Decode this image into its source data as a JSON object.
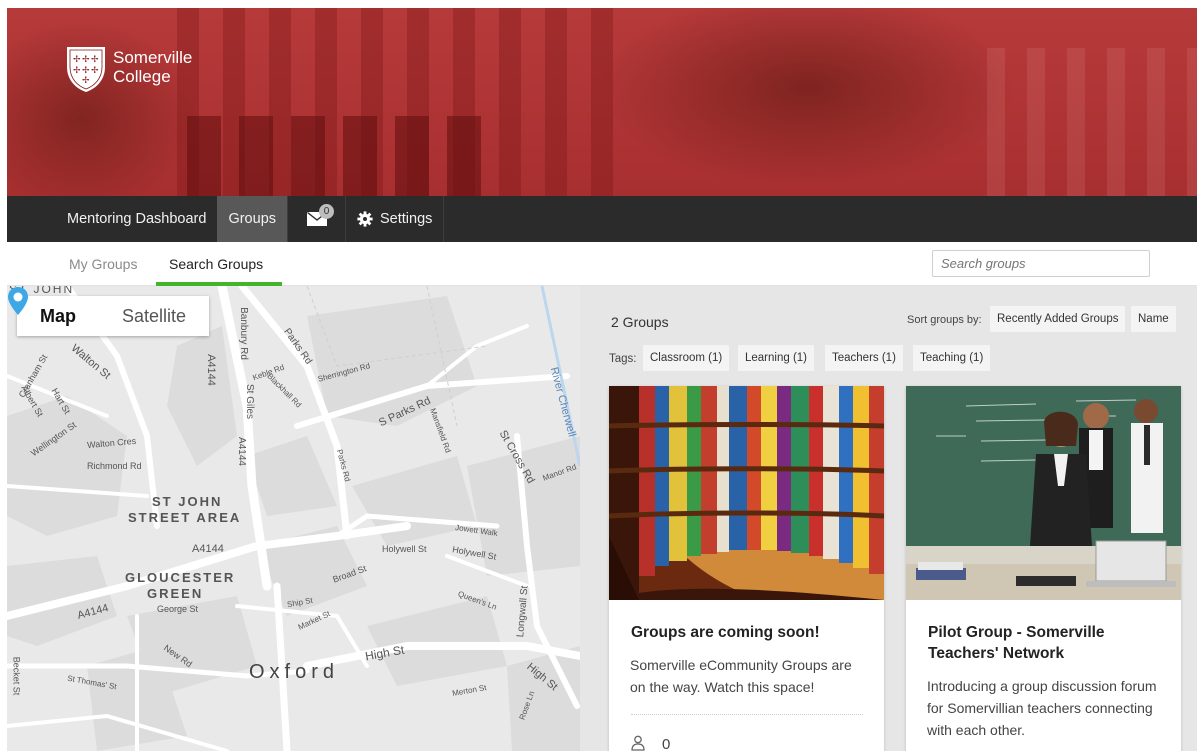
{
  "brand": {
    "line1": "Somerville",
    "line2": "College"
  },
  "nav": {
    "items": [
      {
        "label": "Mentoring Dashboard"
      },
      {
        "label": "Groups"
      }
    ],
    "messages_count": "0",
    "settings_label": "Settings"
  },
  "subnav": {
    "my_groups": "My Groups",
    "search_groups": "Search Groups",
    "search_placeholder": "Search groups"
  },
  "map": {
    "toggle": {
      "map": "Map",
      "satellite": "Satellite"
    },
    "city": "Oxford",
    "areas": {
      "st_john_1": "ST JOHN",
      "st_john_2": "STREET AREA",
      "glouc_1": "GLOUCESTER",
      "glouc_2": "GREEN"
    },
    "streets": {
      "banbury": "Banbury Rd",
      "parks_rd": "Parks Rd",
      "keble": "Keble Rd",
      "sherrington": "Sherrington Rd",
      "s_parks": "S Parks Rd",
      "river": "River Cherwell",
      "st_cross": "St Cross Rd",
      "manor": "Manor Rd",
      "walton_st": "Walton St",
      "walton_cres": "Walton Cres",
      "richmond": "Richmond Rd",
      "wellington": "Wellington St",
      "st_giles": "St Giles",
      "a4144": "A4144",
      "mansfield": "Mansfield Rd",
      "jowett": "Jowett Walk",
      "holywell": "Holywell St",
      "broad": "Broad St",
      "george": "George St",
      "ship": "Ship St",
      "market": "Market St",
      "new_rd": "New Rd",
      "high": "High St",
      "longwall": "Longwall St",
      "queens": "Queen's Ln",
      "st_thomas": "St Thomas' St",
      "merton": "Merton St",
      "becket": "Becket St",
      "rose": "Rose Ln",
      "blackhall": "Blackhall Rd",
      "hart": "Hart St",
      "albert": "Albert St",
      "cranham": "Cranham St"
    }
  },
  "groups": {
    "count_label": "2 Groups",
    "sort_label": "Sort groups by:",
    "sort_options": [
      "Recently Added Groups",
      "Name"
    ],
    "tags_label": "Tags:",
    "tags": [
      "Classroom (1)",
      "Learning (1)",
      "Teachers (1)",
      "Teaching (1)"
    ],
    "cards": [
      {
        "title": "Groups are coming soon!",
        "description": "Somerville eCommunity Groups are on the way. Watch this space!",
        "members": "0",
        "image": "library-bookshelves"
      },
      {
        "title": "Pilot Group - Somerville Teachers' Network",
        "description": "Introducing a group discussion forum for Somervillian teachers connecting with each other.",
        "image": "teachers-classroom"
      }
    ]
  },
  "colors": {
    "hero": "#b03434",
    "nav_bg": "#2b2b2b",
    "nav_active": "#585858",
    "accent_green": "#44b52b",
    "panel_bg": "#e6e6e6",
    "map_bg": "#e9e9e9",
    "pin": "#3ea7e6"
  }
}
